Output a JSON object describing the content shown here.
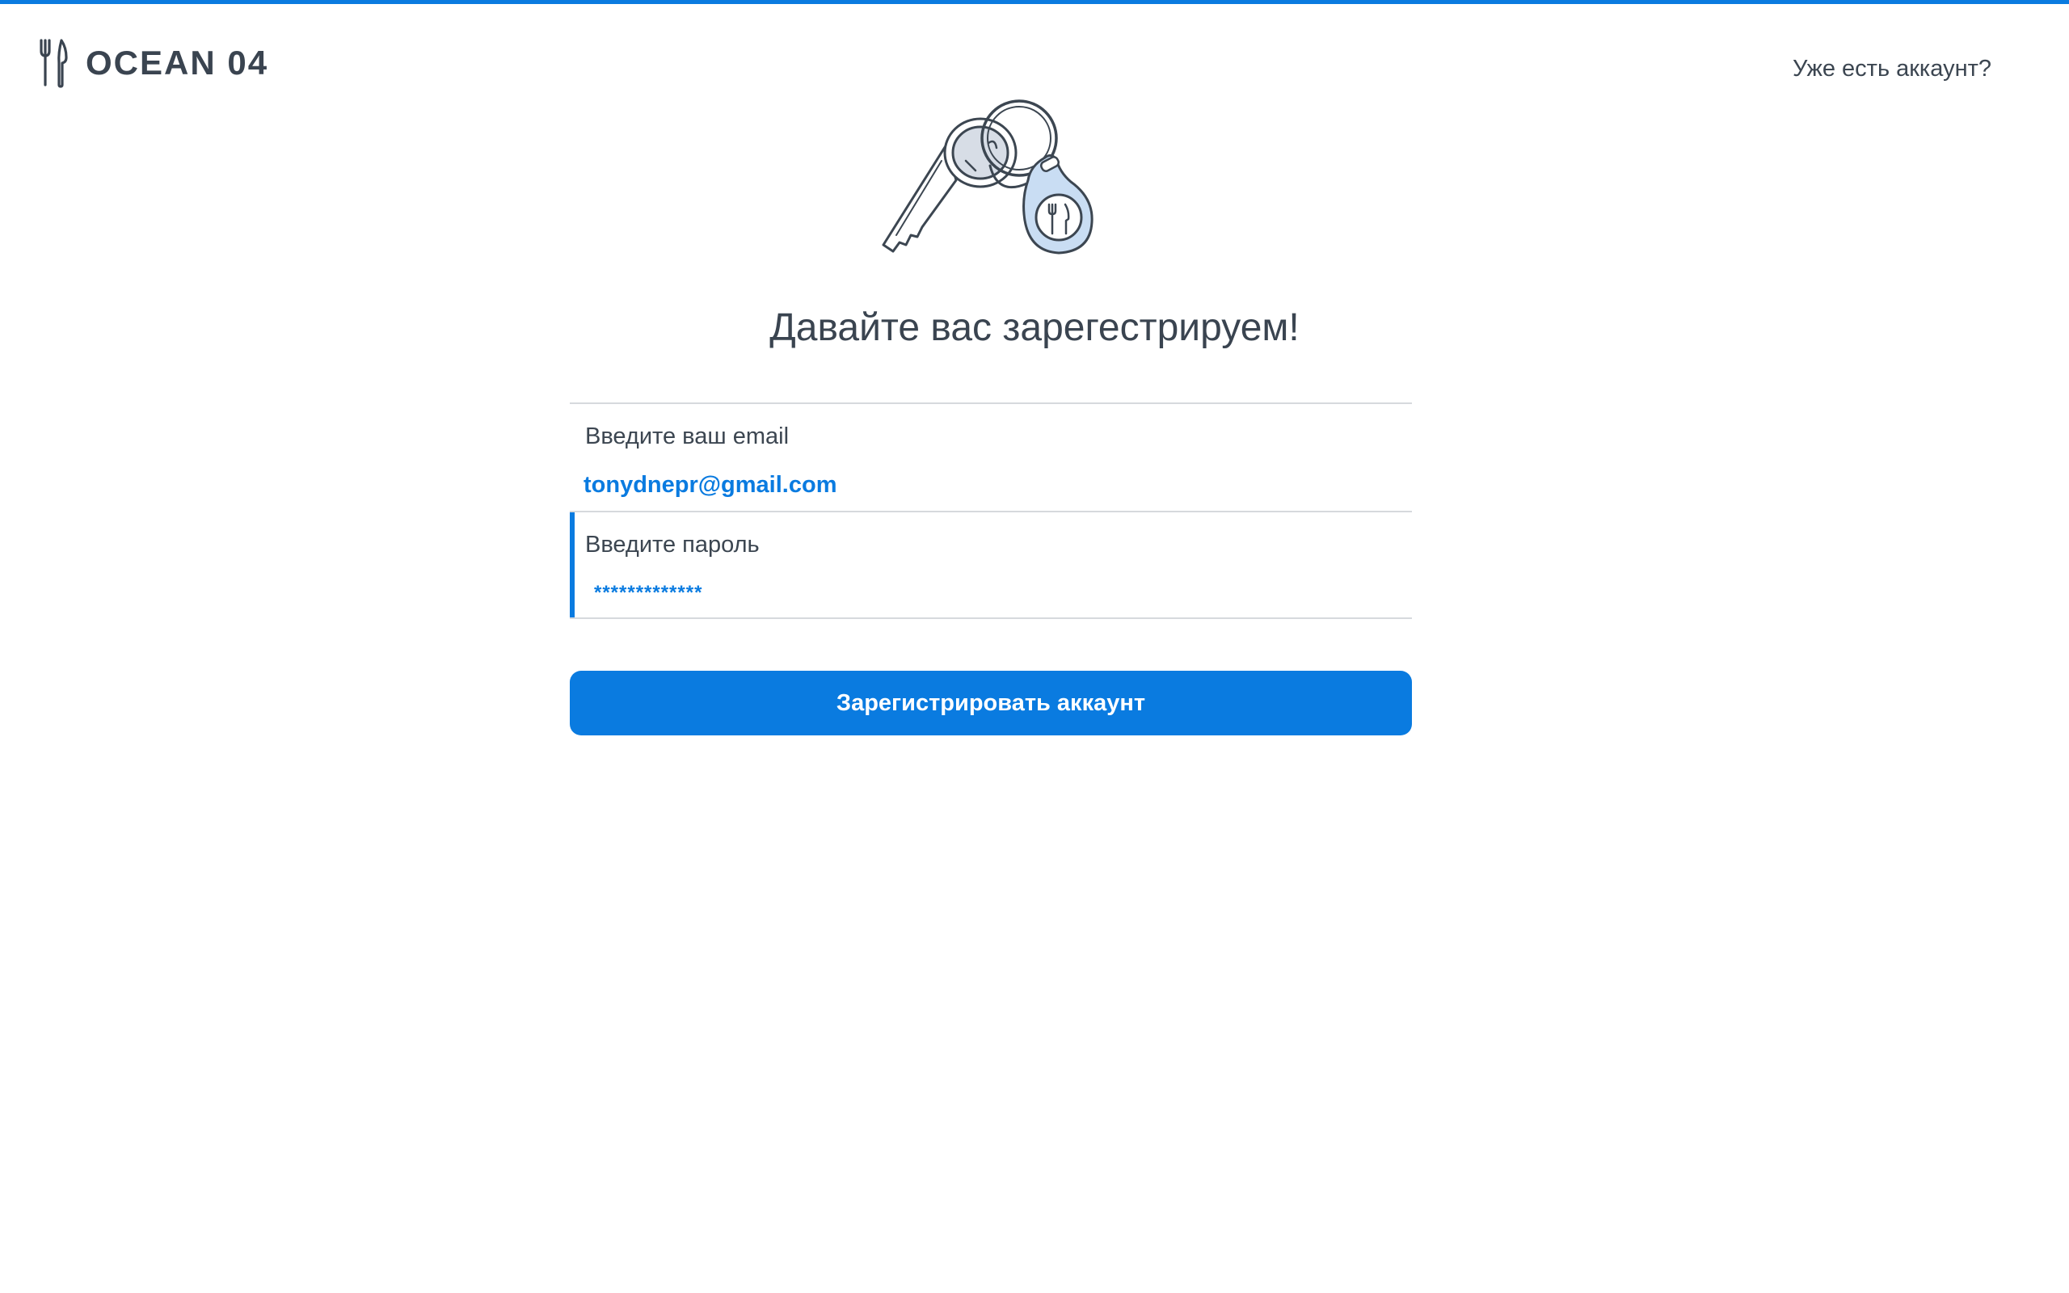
{
  "brand": {
    "name": "OCEAN 04",
    "accent_color": "#0a7be0",
    "icon": "fork-knife-icon"
  },
  "header": {
    "signin_link": "Уже есть аккаунт?"
  },
  "illustration": {
    "icon": "keys-with-keychain-icon"
  },
  "title": "Давайте вас зарегестрируем!",
  "form": {
    "email": {
      "label": "Введите ваш email",
      "value": "tonydnepr@gmail.com"
    },
    "password": {
      "label": "Введите пароль",
      "value": "*************"
    },
    "submit_label": "Зарегистрировать аккаунт"
  }
}
